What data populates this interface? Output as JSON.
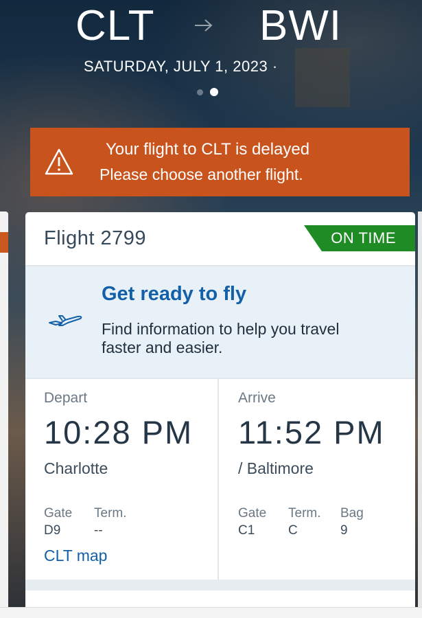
{
  "route": {
    "origin": "CLT",
    "destination": "BWI",
    "date": "SATURDAY, JULY 1, 2023 ·",
    "page_dots": 2,
    "active_dot": 2
  },
  "alert": {
    "title": "Your flight to CLT is delayed",
    "subtitle": "Please choose another flight.",
    "color": "#c9531d"
  },
  "flight": {
    "title": "Flight 2799",
    "status": "ON TIME",
    "status_color": "#1f8b24"
  },
  "promo": {
    "title": "Get ready to fly",
    "text": "Find information to help you travel faster and easier."
  },
  "depart": {
    "label": "Depart",
    "time": "10:28 PM",
    "city": "Charlotte",
    "gate_label": "Gate",
    "gate": "D9",
    "term_label": "Term.",
    "term": "--",
    "map_link": "CLT map"
  },
  "arrive": {
    "label": "Arrive",
    "time": "11:52 PM",
    "city": "/ Baltimore",
    "gate_label": "Gate",
    "gate": "C1",
    "term_label": "Term.",
    "term": "C",
    "bag_label": "Bag",
    "bag": "9"
  },
  "icons": {
    "arrow": "right-arrow-icon",
    "alert": "warning-triangle-icon",
    "promo": "airplane-icon"
  },
  "colors": {
    "link": "#1460a8",
    "promo_bg": "#e8f1f8"
  }
}
